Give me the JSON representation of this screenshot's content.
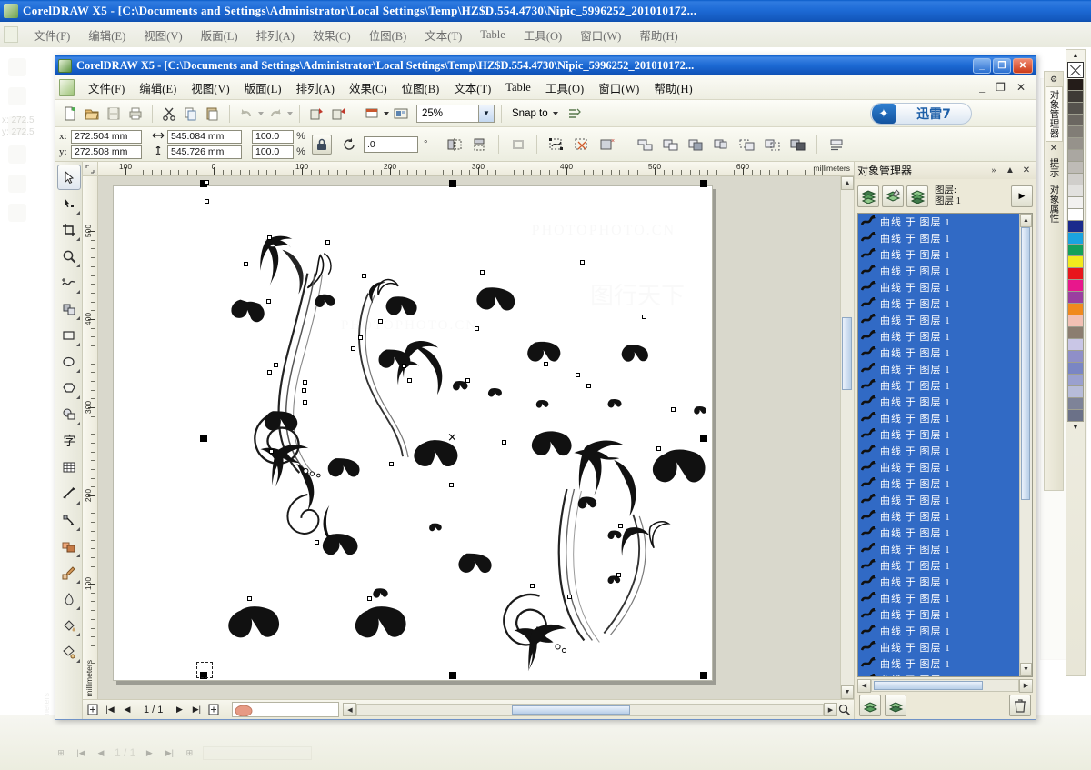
{
  "outer_window": {
    "title": "CorelDRAW X5 - [C:\\Documents and Settings\\Administrator\\Local Settings\\Temp\\HZ$D.554.4730\\Nipic_5996252_201010172...",
    "menus": [
      "文件(F)",
      "编辑(E)",
      "视图(V)",
      "版面(L)",
      "排列(A)",
      "效果(C)",
      "位图(B)",
      "文本(T)",
      "Table",
      "工具(O)",
      "窗口(W)",
      "帮助(H)"
    ],
    "status_page": "1 / 1",
    "coord_x_label": "x:",
    "coord_y_label": "y:",
    "coord_x_value": "272.5",
    "coord_y_value": "272.5",
    "unit_label": "millimeters"
  },
  "app": {
    "title": "CorelDRAW X5 - [C:\\Documents and Settings\\Administrator\\Local Settings\\Temp\\HZ$D.554.4730\\Nipic_5996252_201010172...",
    "window_buttons": {
      "minimize": "_",
      "maximize": "❐",
      "close": "✕"
    },
    "mdi_buttons": {
      "minimize": "_",
      "restore": "❐",
      "close": "✕"
    },
    "menus": [
      {
        "label": "文件(F)",
        "name": "menu-file"
      },
      {
        "label": "编辑(E)",
        "name": "menu-edit"
      },
      {
        "label": "视图(V)",
        "name": "menu-view"
      },
      {
        "label": "版面(L)",
        "name": "menu-layout"
      },
      {
        "label": "排列(A)",
        "name": "menu-arrange"
      },
      {
        "label": "效果(C)",
        "name": "menu-effects"
      },
      {
        "label": "位图(B)",
        "name": "menu-bitmaps"
      },
      {
        "label": "文本(T)",
        "name": "menu-text"
      },
      {
        "label": "Table",
        "name": "menu-table"
      },
      {
        "label": "工具(O)",
        "name": "menu-tools"
      },
      {
        "label": "窗口(W)",
        "name": "menu-window"
      },
      {
        "label": "帮助(H)",
        "name": "menu-help"
      }
    ]
  },
  "toolbar": {
    "zoom_level": "25%",
    "snap_to_label": "Snap to",
    "xunlei_label": "迅雷7",
    "icons": [
      "new-icon",
      "open-icon",
      "save-icon",
      "print-icon",
      "cut-icon",
      "copy-icon",
      "paste-icon",
      "undo-icon",
      "redo-icon",
      "import-icon",
      "export-icon",
      "application-launcher-icon",
      "corel-connect-icon"
    ]
  },
  "property_bar": {
    "x_label": "x:",
    "y_label": "y:",
    "x_value": "272.504 mm",
    "y_value": "272.508 mm",
    "width_value": "545.084 mm",
    "height_value": "545.726 mm",
    "scale_w": "100.0",
    "scale_h": "100.0",
    "percent_symbol": "%",
    "rotation_value": ".0",
    "degree_symbol": "°",
    "lock_icon": "lock-ratio-icon",
    "buttons": [
      "mirror-horizontal-icon",
      "mirror-vertical-icon",
      "outline-width-icon",
      "convert-to-curves-icon",
      "weld-trim-icon",
      "remove-fill-icon",
      "weld-icon",
      "trim-icon",
      "intersect-icon",
      "simplify-icon",
      "front-minus-back-icon",
      "back-minus-front-icon",
      "boundary-icon",
      "wrap-text-icon"
    ]
  },
  "toolbox": [
    {
      "name": "pick-tool",
      "label": "挑选工具",
      "active": true
    },
    {
      "name": "shape-tool",
      "label": "形状工具",
      "active": false
    },
    {
      "name": "crop-tool",
      "label": "裁剪工具",
      "active": false
    },
    {
      "name": "zoom-tool",
      "label": "缩放工具",
      "active": false
    },
    {
      "name": "freehand-tool",
      "label": "手绘工具",
      "active": false
    },
    {
      "name": "smart-fill-tool",
      "label": "智能填充",
      "active": false
    },
    {
      "name": "rectangle-tool",
      "label": "矩形工具",
      "active": false
    },
    {
      "name": "ellipse-tool",
      "label": "椭圆形工具",
      "active": false
    },
    {
      "name": "polygon-tool",
      "label": "多边形工具",
      "active": false
    },
    {
      "name": "basic-shapes-tool",
      "label": "基本形状",
      "active": false
    },
    {
      "name": "text-tool",
      "label": "文本工具",
      "active": false
    },
    {
      "name": "table-tool",
      "label": "表格工具",
      "active": false
    },
    {
      "name": "dimension-tool",
      "label": "度量工具",
      "active": false
    },
    {
      "name": "connector-tool",
      "label": "连接器工具",
      "active": false
    },
    {
      "name": "blend-tool",
      "label": "调和工具",
      "active": false
    },
    {
      "name": "color-eyedropper-tool",
      "label": "颜色滴管",
      "active": false
    },
    {
      "name": "outline-tool",
      "label": "轮廓笔工具",
      "active": false
    },
    {
      "name": "fill-tool",
      "label": "填充工具",
      "active": false
    },
    {
      "name": "interactive-fill-tool",
      "label": "交互式填充",
      "active": false
    }
  ],
  "rulers": {
    "horizontal": {
      "labels": [
        "100",
        "0",
        "100",
        "200",
        "300",
        "400",
        "500",
        "600"
      ],
      "unit": "millimeters"
    },
    "vertical": {
      "labels": [
        "500",
        "400",
        "300",
        "200",
        "100"
      ],
      "unit": "millimeters"
    }
  },
  "status": {
    "page_indicator": "1 / 1",
    "page_tab_label": ""
  },
  "docker": {
    "title": "对象管理器",
    "collapse_icon": "»",
    "up_icon": "▲",
    "close_icon": "✕",
    "layer_label_line1": "图层:",
    "layer_label_line2": "图层 1",
    "options_icon": "▶",
    "buttons": [
      "show-object-properties-icon",
      "edit-across-layers-icon",
      "layer-manager-view-icon"
    ],
    "items": [
      "曲线 于 图层 1",
      "曲线 于 图层 1",
      "曲线 于 图层 1",
      "曲线 于 图层 1",
      "曲线 于 图层 1",
      "曲线 于 图层 1",
      "曲线 于 图层 1",
      "曲线 于 图层 1",
      "曲线 于 图层 1",
      "曲线 于 图层 1",
      "曲线 于 图层 1",
      "曲线 于 图层 1",
      "曲线 于 图层 1",
      "曲线 于 图层 1",
      "曲线 于 图层 1",
      "曲线 于 图层 1",
      "曲线 于 图层 1",
      "曲线 于 图层 1",
      "曲线 于 图层 1",
      "曲线 于 图层 1",
      "曲线 于 图层 1",
      "曲线 于 图层 1",
      "曲线 于 图层 1",
      "曲线 于 图层 1",
      "曲线 于 图层 1",
      "曲线 于 图层 1",
      "曲线 于 图层 1",
      "曲线 于 图层 1",
      "曲线 于 图层 1"
    ],
    "footer_buttons": [
      "new-layer-icon",
      "new-master-layer-icon"
    ],
    "delete_icon": "delete-icon"
  },
  "vertical_tabs": [
    {
      "label": "对象管理器",
      "name": "vtab-object-manager",
      "selected": true
    },
    {
      "label": "提示",
      "name": "vtab-hints",
      "selected": false
    },
    {
      "label": "对象属性",
      "name": "vtab-object-properties",
      "selected": false
    }
  ],
  "palette": {
    "no_color_label": "×",
    "swatches": [
      "#241c19",
      "#3e3a36",
      "#55524d",
      "#6b6761",
      "#817d76",
      "#96928b",
      "#aaa7a1",
      "#bebbb6",
      "#d0cecb",
      "#e2e1df",
      "#f2f1f0",
      "#ffffff",
      "#1a2a8c",
      "#1aa3e0",
      "#14a05a",
      "#f2ea1e",
      "#e8161c",
      "#e8178c",
      "#9a3fa0",
      "#f08a1e",
      "#f2c0b4",
      "#8b7d70",
      "#c9c6e6",
      "#8f8fc8",
      "#7a86c4",
      "#9aa0cf",
      "#b7bcd9",
      "#7e8398",
      "#6b7188"
    ]
  },
  "colors": {
    "title_blue": "#1d6ad4",
    "selection_blue": "#316ac5",
    "chrome": "#ece9d8",
    "accent": "#1d5fa8"
  },
  "canvas": {
    "artwork_description": "黑色蝴蝶与花藤装饰图案",
    "selection_center_marker": "×"
  },
  "watermarks": [
    "PHOTOPHOTO.CN",
    "图行天下"
  ]
}
